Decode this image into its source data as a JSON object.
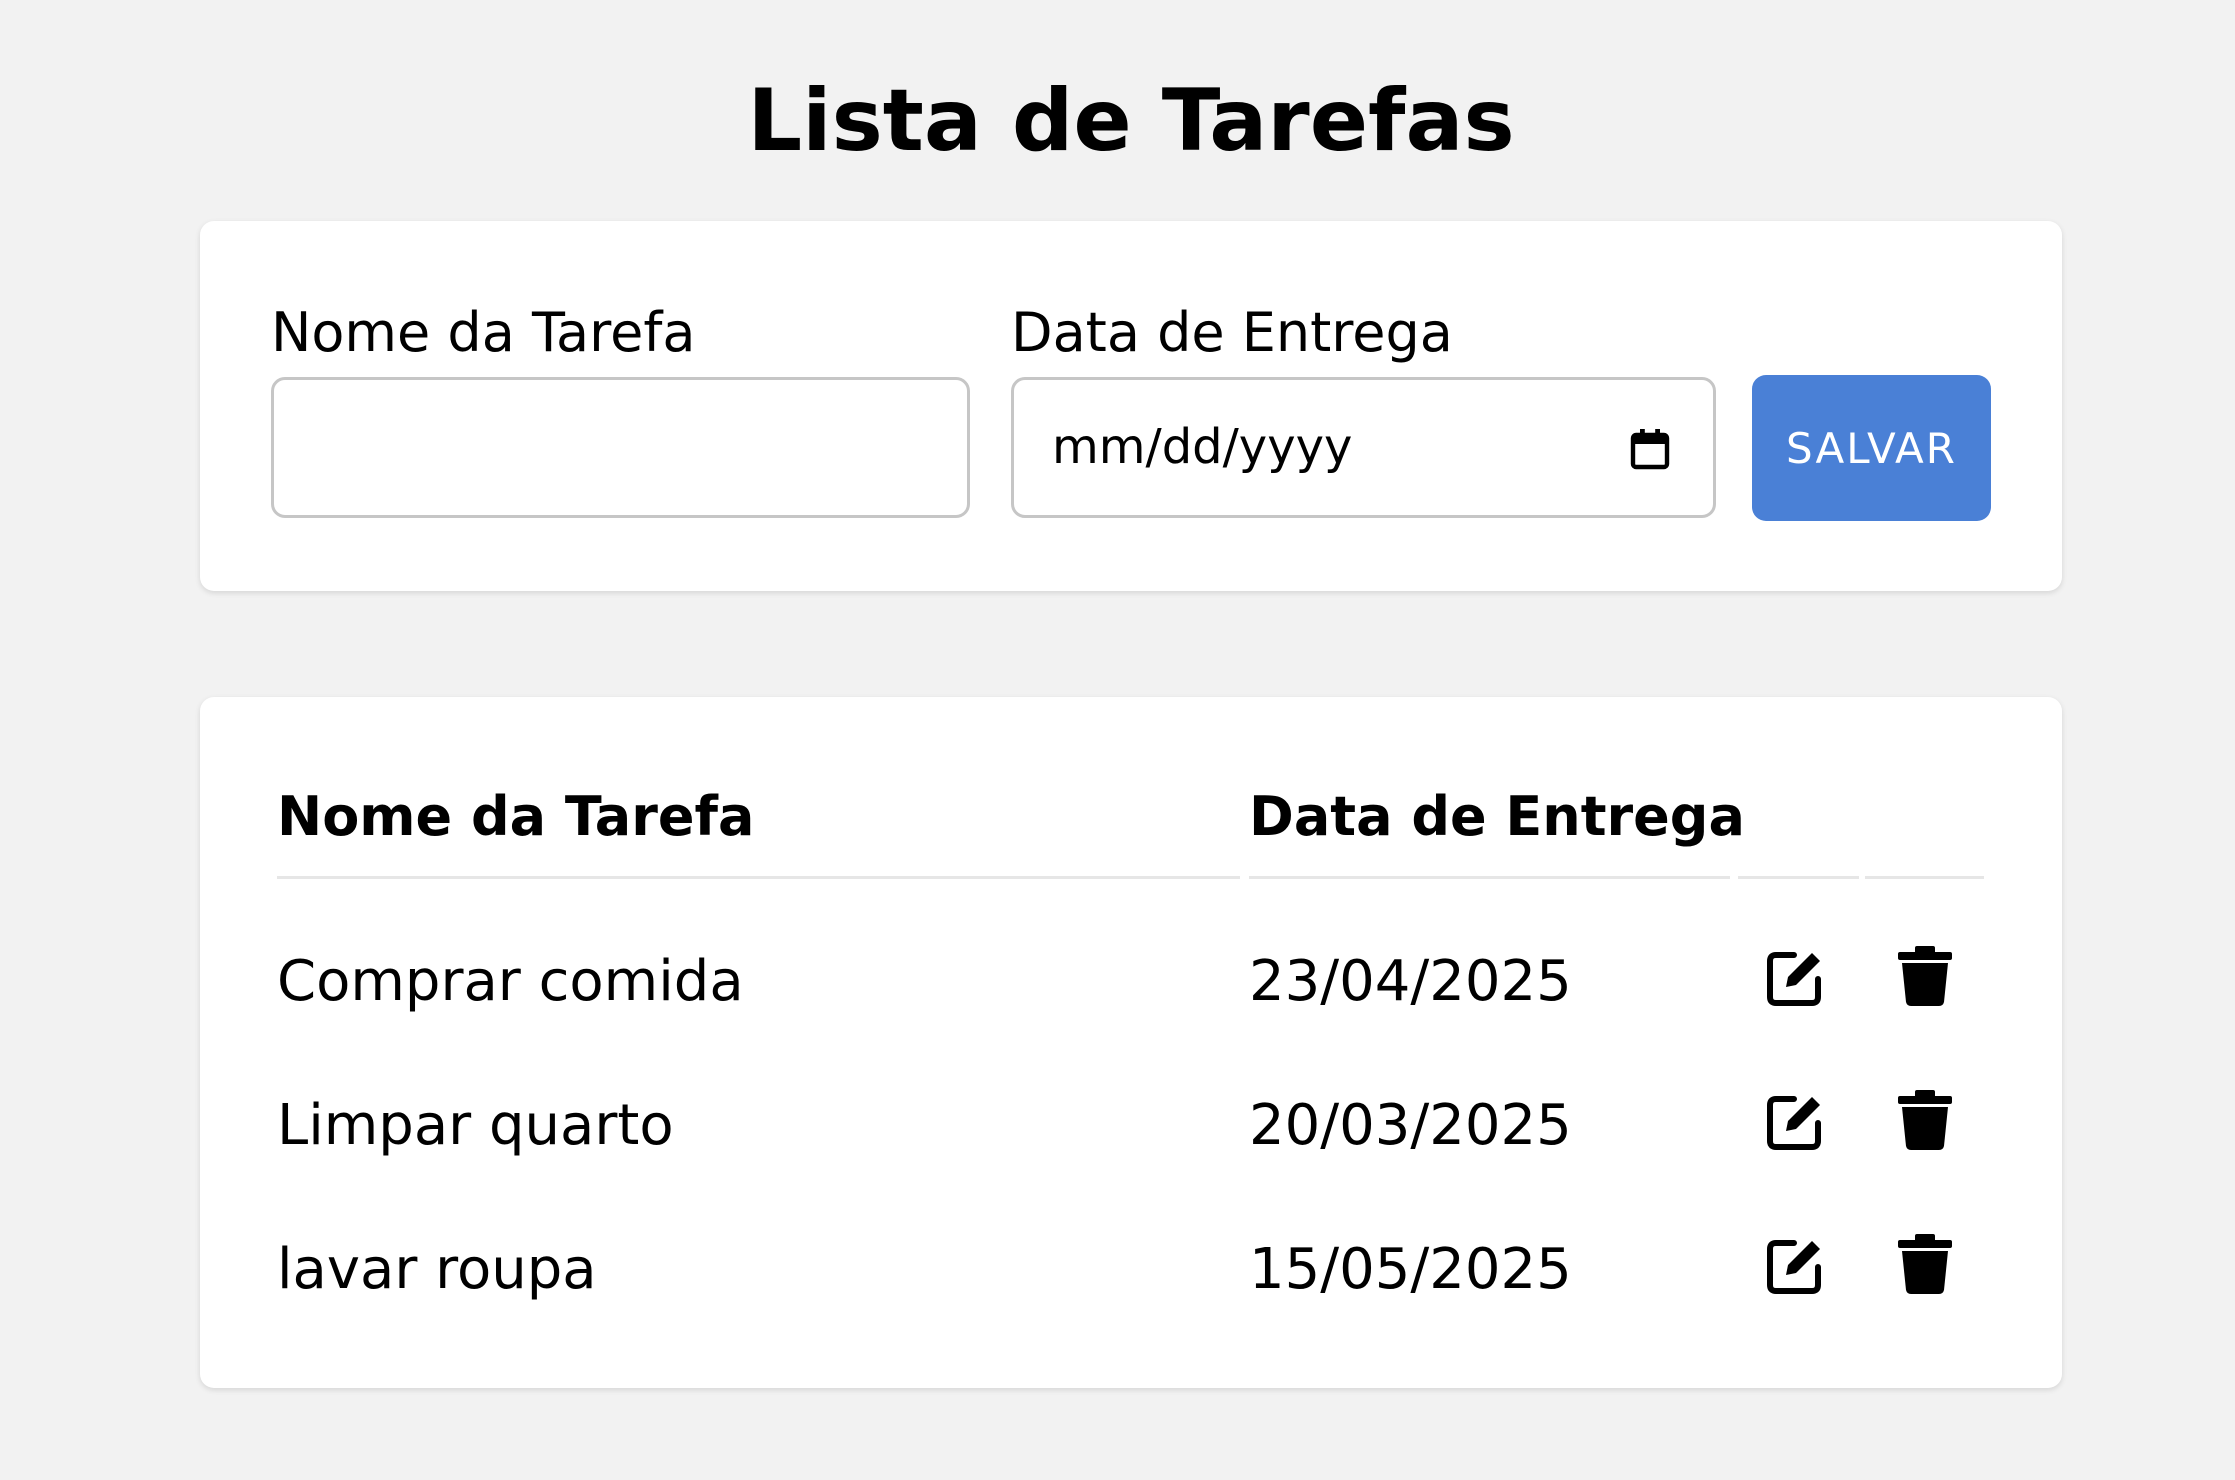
{
  "title": "Lista de Tarefas",
  "form": {
    "name_label": "Nome da Tarefa",
    "name_value": "",
    "date_label": "Data de Entrega",
    "date_placeholder": "mm/dd/yyyy",
    "save_label": "SALVAR"
  },
  "table": {
    "headers": [
      "Nome da Tarefa",
      "Data de Entrega"
    ],
    "rows": [
      {
        "name": "Comprar comida",
        "date": "23/04/2025"
      },
      {
        "name": "Limpar quarto",
        "date": "20/03/2025"
      },
      {
        "name": "lavar roupa",
        "date": "15/05/2025"
      }
    ],
    "row_icons": [
      "edit-icon",
      "trash-icon"
    ]
  },
  "colors": {
    "background": "#f2f2f2",
    "card": "#ffffff",
    "accent": "#4a80d6",
    "input_border": "#c6c6c6",
    "divider": "#e6e6e6"
  }
}
